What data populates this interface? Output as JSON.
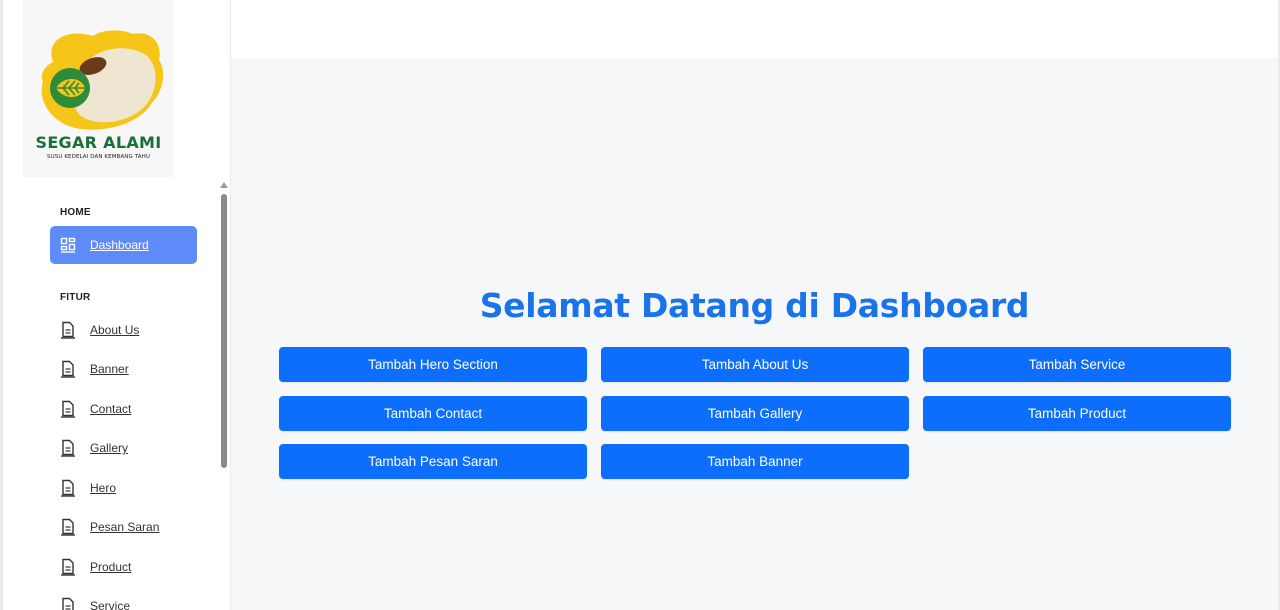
{
  "brand": {
    "name": "SEGAR ALAMI",
    "tagline": "SUSU KEDELAI DAN KEMBANG TAHU",
    "colors": {
      "yellow": "#f5c518",
      "green": "#1b6e3a",
      "cream": "#efe6d2"
    }
  },
  "sidebar": {
    "sections": [
      {
        "label": "HOME"
      },
      {
        "label": "FITUR"
      }
    ],
    "home_items": [
      {
        "label": "Dashboard",
        "icon": "dashboard-grid-icon",
        "active": true
      }
    ],
    "fitur_items": [
      {
        "label": "About Us",
        "icon": "document-icon"
      },
      {
        "label": "Banner",
        "icon": "document-icon"
      },
      {
        "label": "Contact",
        "icon": "document-icon"
      },
      {
        "label": "Gallery",
        "icon": "document-icon"
      },
      {
        "label": "Hero",
        "icon": "document-icon"
      },
      {
        "label": "Pesan Saran",
        "icon": "document-icon"
      },
      {
        "label": "Product",
        "icon": "document-icon"
      },
      {
        "label": "Service",
        "icon": "document-icon"
      }
    ]
  },
  "main": {
    "welcome_title": "Selamat Datang di Dashboard",
    "buttons": [
      "Tambah Hero Section",
      "Tambah About Us",
      "Tambah Service",
      "Tambah Contact",
      "Tambah Gallery",
      "Tambah Product",
      "Tambah Pesan Saran",
      "Tambah Banner"
    ]
  },
  "colors": {
    "accent": "#0d6efd",
    "title": "#1a73e8",
    "active_nav": "#5e8bf7",
    "content_bg": "#f6f7f9"
  }
}
